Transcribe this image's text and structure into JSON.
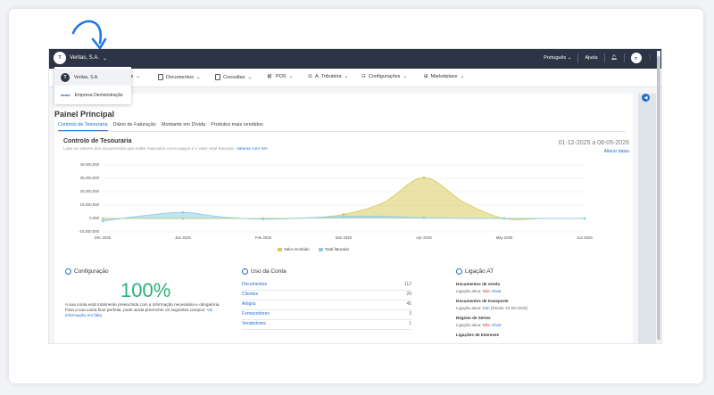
{
  "topbar": {
    "company": "Veritas, S.A.",
    "language": "Português",
    "help": "Ajuda",
    "logo_text": "T",
    "avatar_text": "T"
  },
  "dropdown": {
    "items": [
      {
        "label": "Veritas, S.A."
      },
      {
        "label": "Empresa Demonstração",
        "logo": "demo"
      }
    ]
  },
  "menu": {
    "items": [
      {
        "label": "Tabelas"
      },
      {
        "label": "Documentos"
      },
      {
        "label": "Consultas"
      },
      {
        "label": "POS"
      },
      {
        "label": "A. Tributária"
      },
      {
        "label": "Configurações"
      },
      {
        "label": "Marketplace"
      }
    ],
    "first_visible": "mas"
  },
  "page": {
    "title": "Painel Principal",
    "tabs": [
      "Controlo de Tesouraria",
      "Diário de Faturação",
      "Montante em Dívida",
      "Produtos mais vendidos"
    ],
    "section_title": "Controlo de Tesouraria",
    "section_sub": "Lista os valores dos documentos que estão marcados como pagos e o valor total faturado.",
    "section_sub_link": "Valores com IVA",
    "date_range": "01-12-2025 a 08-05-2026",
    "change_dates": "Alterar datas"
  },
  "chart_data": {
    "type": "area",
    "categories": [
      "Dec 2025",
      "Jan 2026",
      "Feb 2026",
      "Mar 2026",
      "Apr 2026",
      "May 2026",
      "Jun 2026"
    ],
    "x": [
      0,
      0.5,
      1,
      1.5,
      2,
      2.5,
      3,
      3.5,
      4,
      4.5,
      5,
      5.5,
      6
    ],
    "ytick_labels": [
      "40,000,000",
      "30,000,000",
      "20,000,000",
      "10,000,000",
      "0,000",
      "-10,000,000"
    ],
    "ylim": [
      -10000000,
      40000000
    ],
    "series": [
      {
        "name": "Valor recebido",
        "color": "#d7cc5e",
        "values": [
          0,
          0,
          0,
          0,
          0,
          300000,
          3000000,
          12000000,
          30500000,
          12000000,
          0,
          0,
          0
        ],
        "points_at": [
          0,
          2,
          4,
          6,
          8,
          10,
          12
        ]
      },
      {
        "name": "Total faturado",
        "color": "#8fcde6",
        "values": [
          -2000000,
          2000000,
          4500000,
          1000000,
          -500000,
          300000,
          1500000,
          1500000,
          500000,
          0,
          0,
          0,
          0
        ],
        "points_at": [
          0,
          2,
          4,
          6,
          8,
          10,
          12
        ]
      }
    ]
  },
  "config": {
    "title": "Configuração",
    "percent": "100%",
    "text1": "A sua conta está totalmente preenchida com a informação necessária e obrigatória.",
    "text2": "Para a sua conta ficar perfeita, pode ainda preencher os seguintes campos:",
    "link": "Ver informação em falta"
  },
  "usage": {
    "title": "Uso da Conta",
    "rows": [
      {
        "label": "Documentos",
        "count": "112"
      },
      {
        "label": "Clientes",
        "count": "29"
      },
      {
        "label": "Artigos",
        "count": "45"
      },
      {
        "label": "Fornecedores",
        "count": "3"
      },
      {
        "label": "Vendedores",
        "count": "1"
      }
    ]
  },
  "at": {
    "title": "Ligação AT",
    "s1_title": "Documentos de venda",
    "s1_active": "Ligação ativa:",
    "s1_value": "Não",
    "s1_action": "Ativar",
    "s2_title": "Documentos de transporte",
    "s2_active": "Ligação ativa:",
    "s2_value": "Sim",
    "s2_since": "(Desde 10-09-2025)",
    "s3_title": "Registo de Séries",
    "s3_active": "Ligação ativa:",
    "s3_value": "Não",
    "s3_action": "Ativar",
    "s4_title": "Ligações de Interesse"
  }
}
